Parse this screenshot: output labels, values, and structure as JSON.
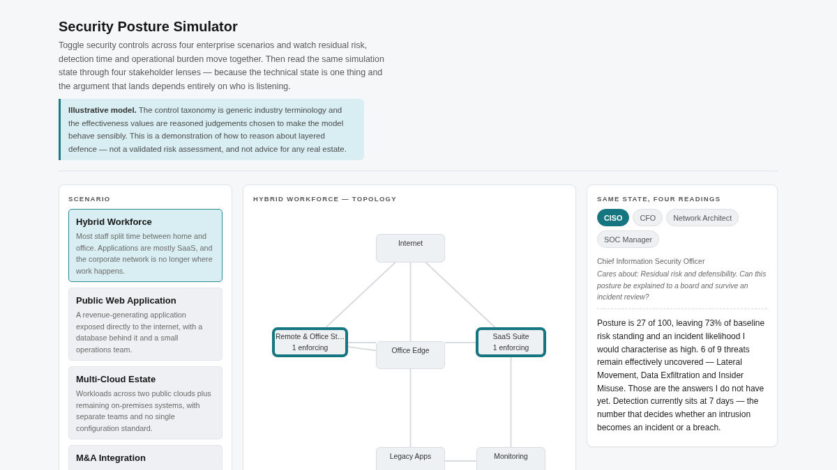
{
  "page": {
    "title": "Security Posture Simulator",
    "intro": "Toggle security controls across four enterprise scenarios and watch residual risk, detection time and operational burden move together. Then read the same simulation state through four stakeholder lenses — because the technical state is one thing and the argument that lands depends entirely on who is listening.",
    "callout": "**Illustrative model.** The control taxonomy is generic industry terminology and the effectiveness values are reasoned judgements chosen to make the model behave sensibly. This is a demonstration of how to reason about layered defence — not a validated risk assessment, and not advice for any real estate."
  },
  "scenario_panel": {
    "heading": "SCENARIO",
    "scenarios": [
      {
        "title": "Hybrid Workforce",
        "description": "Most staff split time between home and office. Applications are mostly SaaS, and the corporate network is no longer where work happens.",
        "selected": true
      },
      {
        "title": "Public Web Application",
        "description": "A revenue-generating application exposed directly to the internet, with a database behind it and a small operations team.",
        "selected": false
      },
      {
        "title": "Multi-Cloud Estate",
        "description": "Workloads across two public clouds plus remaining on-premises systems, with separate teams and no single configuration standard.",
        "selected": false
      },
      {
        "title": "M&A Integration",
        "selected": false
      }
    ]
  },
  "topology_panel": {
    "heading": "HYBRID WORKFORCE — TOPOLOGY",
    "nodes": [
      {
        "label": "Internet",
        "enforcing": false
      },
      {
        "label": "Remote & Office St…",
        "detail": "1 enforcing",
        "enforcing": true
      },
      {
        "label": "Office Edge",
        "enforcing": false
      },
      {
        "label": "SaaS Suite",
        "detail": "1 enforcing",
        "enforcing": true
      },
      {
        "label": "Legacy Apps",
        "enforcing": false
      },
      {
        "label": "Monitoring",
        "enforcing": false
      }
    ]
  },
  "readings_panel": {
    "heading": "SAME STATE, FOUR READINGS",
    "lenses": [
      {
        "label": "CISO",
        "selected": true
      },
      {
        "label": "CFO",
        "selected": false
      },
      {
        "label": "Network Architect",
        "selected": false
      },
      {
        "label": "SOC Manager",
        "selected": false
      }
    ],
    "role": "Chief Information Security Officer",
    "cares_about": "Cares about: Residual risk and defensibility. Can this posture be explained to a board and survive an incident review?",
    "reading": "Posture is 27 of 100, leaving 73% of baseline risk standing and an incident likelihood I would characterise as high. 6 of 9 threats remain effectively uncovered — Lateral Movement, Data Exfiltration and Insider Misuse. Those are the answers I do not have yet. Detection currently sits at 7 days — the number that decides whether an intrusion becomes an incident or a breach."
  }
}
